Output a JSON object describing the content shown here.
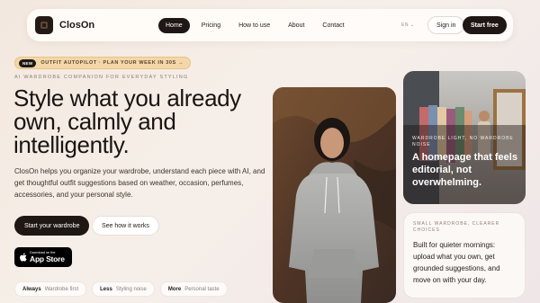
{
  "nav": {
    "brand": "ClosOn",
    "links": [
      "Home",
      "Pricing",
      "How to use",
      "About",
      "Contact"
    ],
    "lang": "EN ⌄",
    "signin": "Sign in",
    "start": "Start free"
  },
  "announce": {
    "badge": "NEW",
    "text": "OUTFIT AUTOPILOT · PLAN YOUR WEEK IN 30S →"
  },
  "hero": {
    "eyebrow": "AI WARDROBE COMPANION FOR EVERYDAY STYLING",
    "headline": "Style what you already own, calmly and intelligently.",
    "subcopy": "ClosOn helps you organize your wardrobe, understand each piece with AI, and get thoughtful outfit suggestions based on weather, occasion, perfumes, accessories, and your personal style.",
    "cta_primary": "Start your wardrobe",
    "cta_secondary": "See how it works"
  },
  "appstore": {
    "small": "Download on the",
    "big": "App Store"
  },
  "chips": [
    {
      "strong": "Always",
      "text": "Wardrobe first"
    },
    {
      "strong": "Less",
      "text": "Styling noise"
    },
    {
      "strong": "More",
      "text": "Personal taste"
    }
  ],
  "store_card": {
    "eyebrow": "WARDROBE LIGHT, NO WARDROBE NOISE",
    "title": "A homepage that feels editorial, not overwhelming."
  },
  "note_card": {
    "eyebrow": "SMALL WARDROBE, CLEARER CHOICES",
    "body": "Built for quieter mornings: upload what you own, get grounded suggestions, and move on with your day."
  },
  "colors": {
    "ink": "#1e1713",
    "badge": "#f4d7a8",
    "background": "#f3e8df"
  }
}
